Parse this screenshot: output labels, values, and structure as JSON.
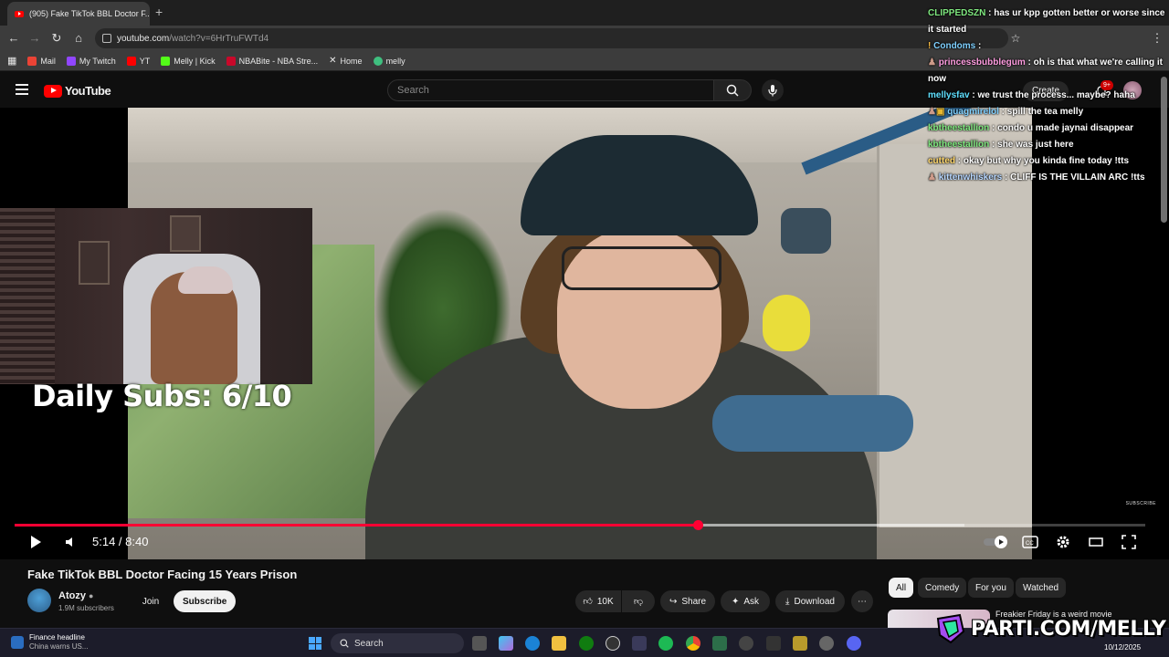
{
  "browser": {
    "tab_title": "(905) Fake TikTok BBL Doctor F...",
    "url_host": "youtube.com",
    "url_path": "/watch?v=6HrTruFWTd4",
    "bookmarks": [
      {
        "label": "Mail",
        "color": "#ea4335"
      },
      {
        "label": "My Twitch",
        "color": "#9146ff"
      },
      {
        "label": "YT",
        "color": "#ff0000"
      },
      {
        "label": "Melly | Kick",
        "color": "#53fc18"
      },
      {
        "label": "NBABite - NBA Stre...",
        "color": "#c9082a"
      },
      {
        "label": "Home",
        "color": "#ffffff"
      },
      {
        "label": "melly",
        "color": "#3fbf7f"
      }
    ]
  },
  "youtube": {
    "logo": "YouTube",
    "search_placeholder": "Search",
    "create_label": "Create",
    "notif_count": "9+"
  },
  "video": {
    "overlay_text": "Daily Subs: 6/10",
    "subscribe_mark": "SUBSCRIBE",
    "current_time": "5:14",
    "duration": "8:40",
    "time_display": "5:14 / 8:40",
    "progress": 0.604,
    "buffered": 0.84
  },
  "meta": {
    "title": "Fake TikTok BBL Doctor Facing 15 Years Prison",
    "channel": "Atozy",
    "subscribers": "1.9M subscribers",
    "join_label": "Join",
    "subscribe_label": "Subscribe",
    "likes": "10K",
    "share_label": "Share",
    "ask_label": "Ask",
    "download_label": "Download"
  },
  "chips": [
    "All",
    "Comedy",
    "For you",
    "Watched"
  ],
  "recommendation": {
    "title": "Freakier Friday is a weird movie"
  },
  "chat": [
    {
      "user": "CLIPPEDSZN",
      "text": "has ur kpp gotten better or worse since it started",
      "color": "#7fe87f"
    },
    {
      "user": "Condoms",
      "text": "",
      "color": "#7fd0ff"
    },
    {
      "user": "princessbubblegum",
      "text": "oh is that what we're calling it now",
      "color": "#ff9de0"
    },
    {
      "user": "mellysfav",
      "text": "we trust the process... maybe? haha",
      "color": "#5fe0ff"
    },
    {
      "user": "quagmirelol",
      "text": "spill the tea melly",
      "color": "#7fd0ff"
    },
    {
      "user": "kbtheestallion",
      "text": "condo u made jaynai disappear",
      "color": "#7fe87f"
    },
    {
      "user": "kbtheestallion",
      "text": "she was just here",
      "color": "#7fe87f"
    },
    {
      "user": "cutted",
      "text": "okay but why you kinda fine today !tts",
      "color": "#ffd76b"
    },
    {
      "user": "kittenwhiskers",
      "text": "CLIFF IS THE VILLAIN ARC !tts",
      "color": "#b7d7ff"
    }
  ],
  "taskbar": {
    "news_title": "Finance headline",
    "news_sub": "China warns US...",
    "search_placeholder": "Search",
    "date": "10/12/2025"
  },
  "watermark": "PARTI.COM/MELLY"
}
